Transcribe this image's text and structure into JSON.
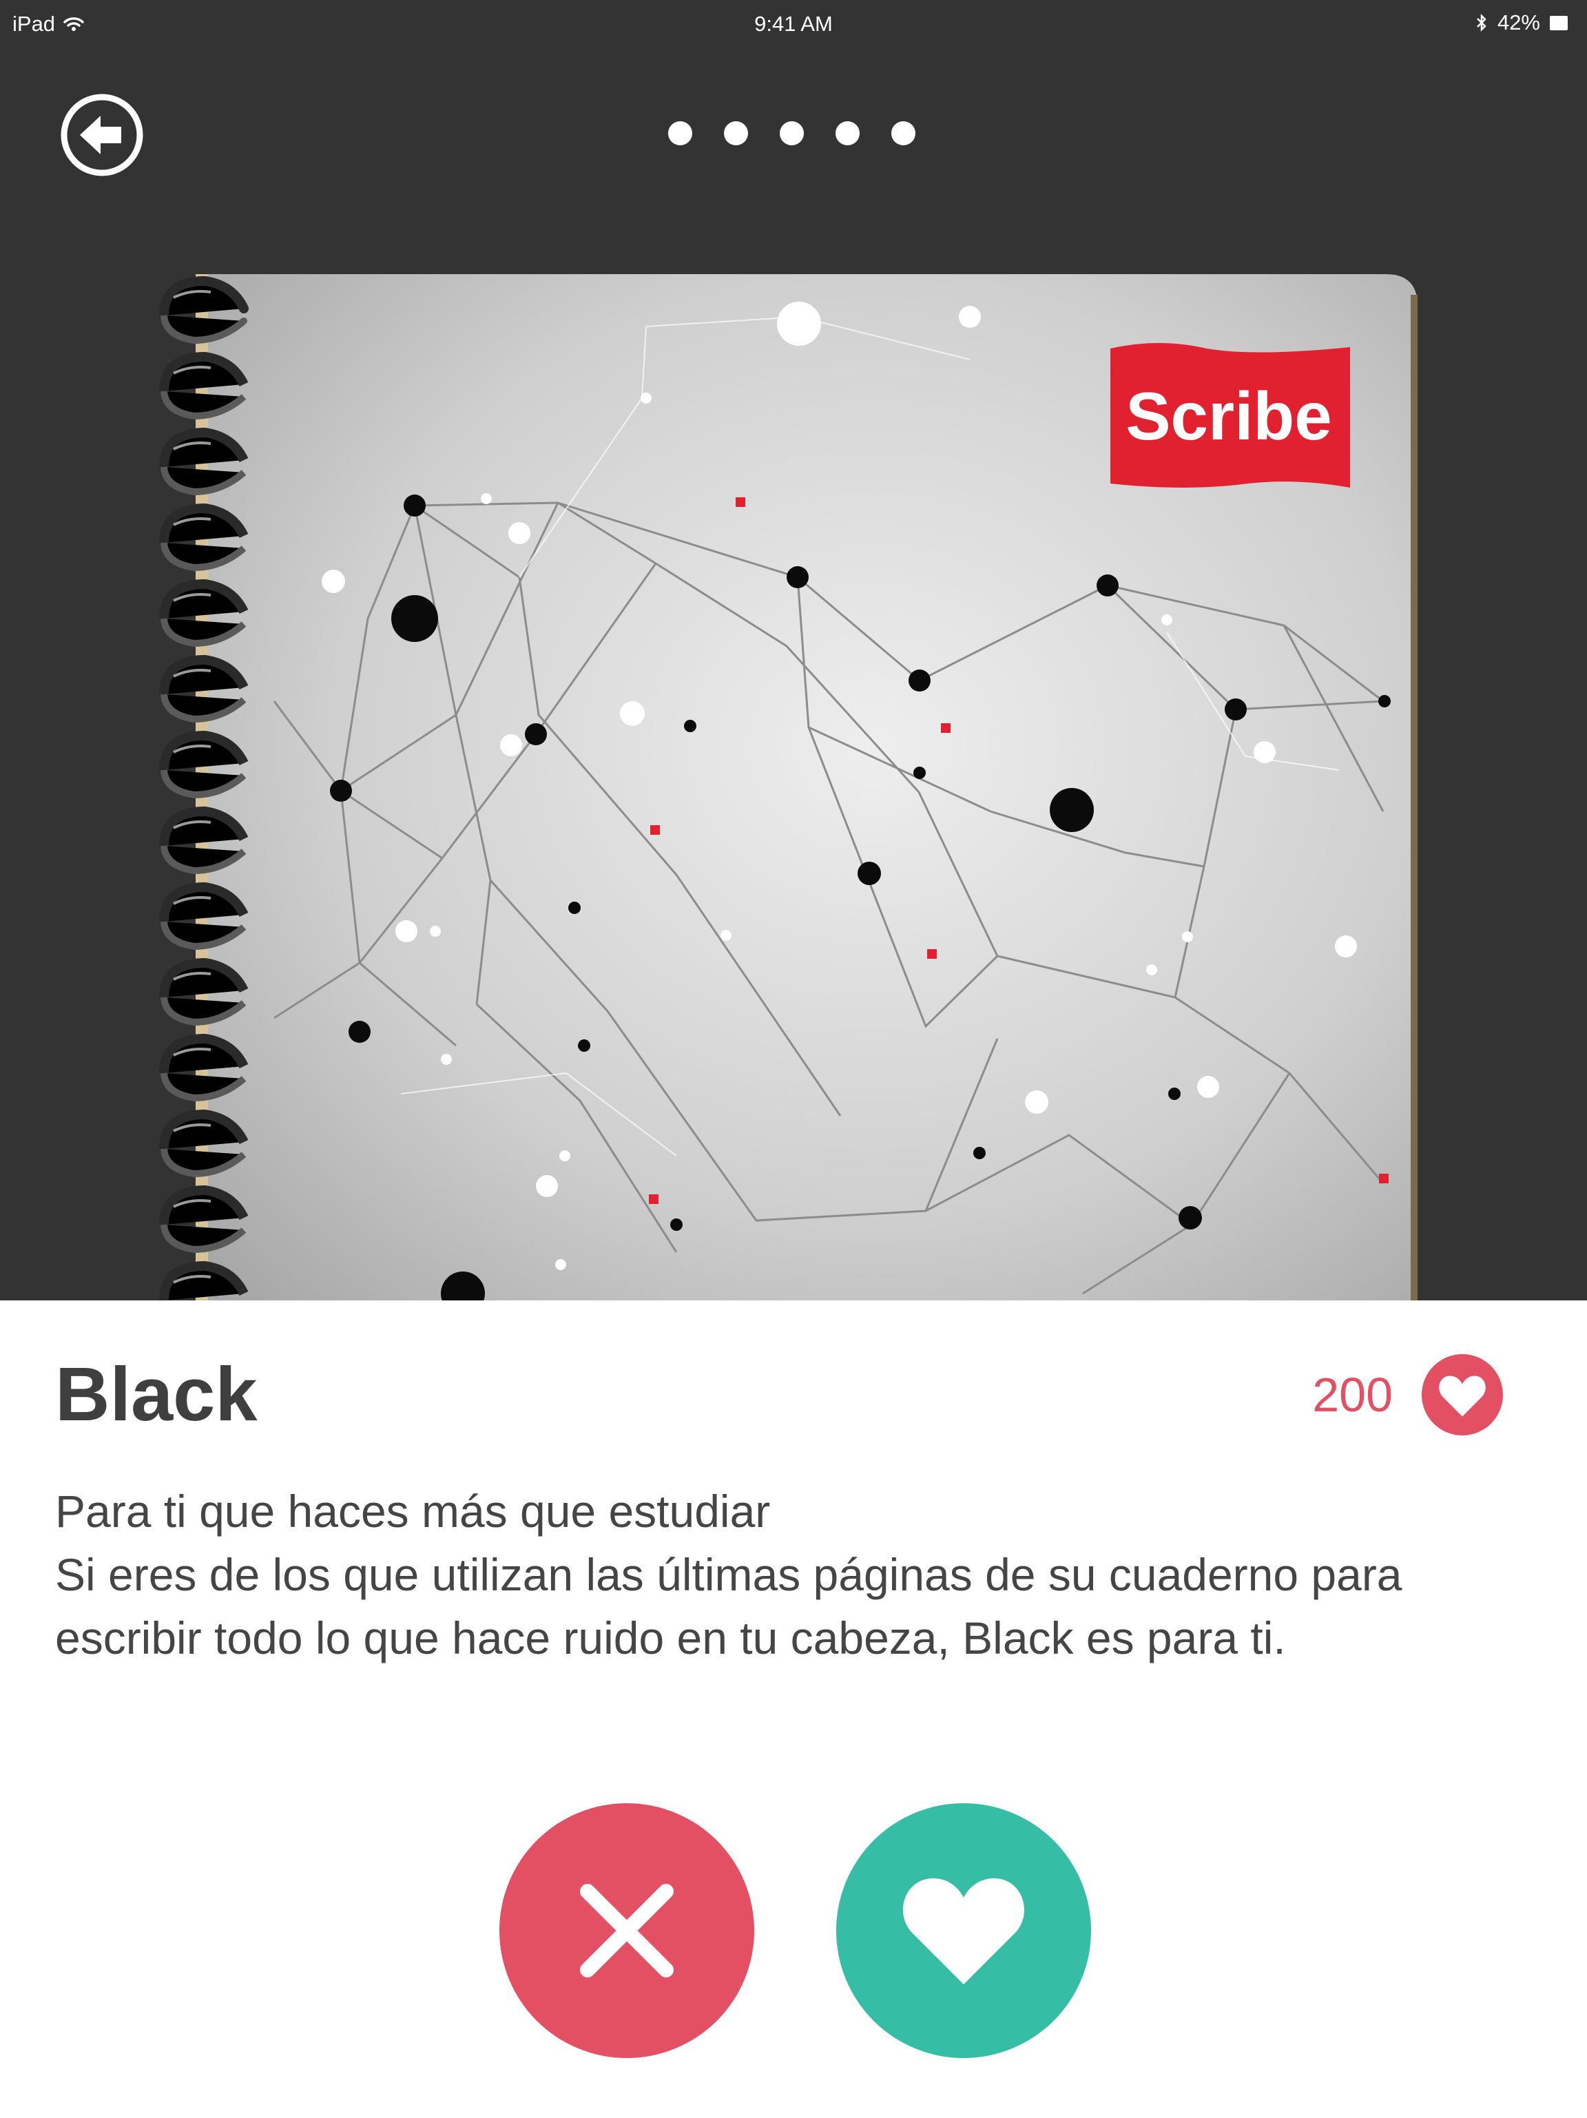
{
  "status_bar": {
    "device": "iPad",
    "time": "9:41 AM",
    "battery": "42%",
    "icons": [
      "wifi-icon",
      "bluetooth-icon",
      "battery-icon"
    ]
  },
  "header": {
    "back_icon": "back-arrow-icon",
    "pagination_dots": 5
  },
  "product_image": {
    "brand_logo": "Scribe",
    "logo_color": "#e1212f"
  },
  "product": {
    "name": "Black",
    "like_count": "200",
    "description_line1": "Para ti que haces más que estudiar",
    "description_line2": "Si eres de los que utilizan las últimas páginas de su cuaderno para escribir todo lo que hace ruido en tu cabeza, Black es para ti."
  },
  "actions": {
    "dislike_icon": "close-icon",
    "like_icon": "heart-icon"
  },
  "colors": {
    "header_bg": "#333333",
    "accent_red": "#e35064",
    "accent_green": "#35bda6",
    "text": "#454545"
  }
}
